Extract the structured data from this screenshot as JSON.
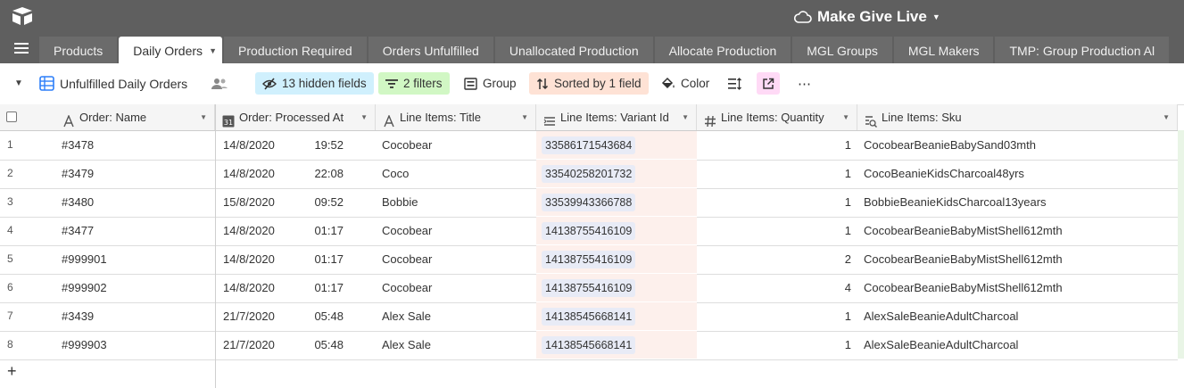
{
  "base": {
    "title": "Make Give Live"
  },
  "tabs": [
    {
      "label": "Products",
      "active": false
    },
    {
      "label": "Daily Orders",
      "active": true
    },
    {
      "label": "Production Required",
      "active": false
    },
    {
      "label": "Orders Unfulfilled",
      "active": false
    },
    {
      "label": "Unallocated Production",
      "active": false
    },
    {
      "label": "Allocate Production",
      "active": false
    },
    {
      "label": "MGL Groups",
      "active": false
    },
    {
      "label": "MGL Makers",
      "active": false
    },
    {
      "label": "TMP: Group Production Al",
      "active": false
    }
  ],
  "view": {
    "name": "Unfulfilled Daily Orders",
    "hidden_fields": "13 hidden fields",
    "filters": "2 filters",
    "group": "Group",
    "sorted": "Sorted by 1 field",
    "color": "Color",
    "more": "⋯"
  },
  "colors": {
    "hidden": "#d0f0fd",
    "filters": "#d1f7c4",
    "sorted": "#fee2d5",
    "share": "#ffdaf6"
  },
  "columns": [
    {
      "label": "Order: Name",
      "icon": "text-field-icon"
    },
    {
      "label": "Order: Processed At",
      "icon": "date-field-icon"
    },
    {
      "label": "Line Items: Title",
      "icon": "text-field-icon"
    },
    {
      "label": "Line Items: Variant Id",
      "icon": "link-field-icon"
    },
    {
      "label": "Line Items: Quantity",
      "icon": "number-field-icon"
    },
    {
      "label": "Line Items: Sku",
      "icon": "lookup-field-icon"
    }
  ],
  "rows": [
    {
      "num": "1",
      "name": "#3478",
      "date": "14/8/2020",
      "time": "19:52",
      "title": "Cocobear",
      "variant": "33586171543684",
      "qty": "1",
      "sku": "CocobearBeanieBabySand03mth"
    },
    {
      "num": "2",
      "name": "#3479",
      "date": "14/8/2020",
      "time": "22:08",
      "title": "Coco",
      "variant": "33540258201732",
      "qty": "1",
      "sku": "CocoBeanieKidsCharcoal48yrs"
    },
    {
      "num": "3",
      "name": "#3480",
      "date": "15/8/2020",
      "time": "09:52",
      "title": "Bobbie",
      "variant": "33539943366788",
      "qty": "1",
      "sku": "BobbieBeanieKidsCharcoal13years"
    },
    {
      "num": "4",
      "name": "#3477",
      "date": "14/8/2020",
      "time": "01:17",
      "title": "Cocobear",
      "variant": "14138755416109",
      "qty": "1",
      "sku": "CocobearBeanieBabyMistShell612mth"
    },
    {
      "num": "5",
      "name": "#999901",
      "date": "14/8/2020",
      "time": "01:17",
      "title": "Cocobear",
      "variant": "14138755416109",
      "qty": "2",
      "sku": "CocobearBeanieBabyMistShell612mth"
    },
    {
      "num": "6",
      "name": "#999902",
      "date": "14/8/2020",
      "time": "01:17",
      "title": "Cocobear",
      "variant": "14138755416109",
      "qty": "4",
      "sku": "CocobearBeanieBabyMistShell612mth"
    },
    {
      "num": "7",
      "name": "#3439",
      "date": "21/7/2020",
      "time": "05:48",
      "title": "Alex Sale",
      "variant": "14138545668141",
      "qty": "1",
      "sku": "AlexSaleBeanieAdultCharcoal"
    },
    {
      "num": "8",
      "name": "#999903",
      "date": "21/7/2020",
      "time": "05:48",
      "title": "Alex Sale",
      "variant": "14138545668141",
      "qty": "1",
      "sku": "AlexSaleBeanieAdultCharcoal"
    }
  ],
  "add_row": "+"
}
